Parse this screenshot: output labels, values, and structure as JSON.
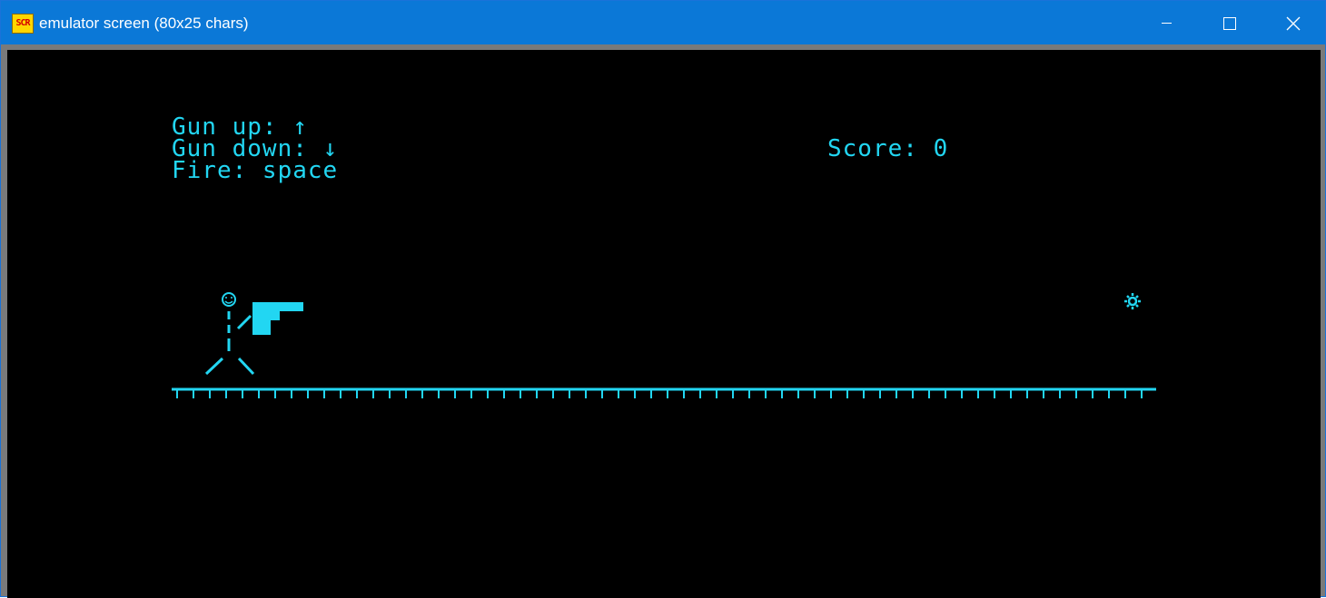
{
  "window": {
    "title": "emulator screen (80x25 chars)",
    "icon_label": "SCR",
    "icon_name": "app-icon",
    "controls": [
      "minimize-icon",
      "maximize-icon",
      "close-icon"
    ]
  },
  "game": {
    "help_lines": [
      "Gun up: ↑",
      "Gun down: ↓",
      "Fire: space"
    ],
    "score_text": "Score: 0",
    "sprites": [
      "stick-figure-player",
      "pistol",
      "target-star",
      "ground"
    ]
  },
  "colors": {
    "titlebar": "#0b78d7",
    "screen_bg": "#000000",
    "text": "#22d6f2"
  }
}
